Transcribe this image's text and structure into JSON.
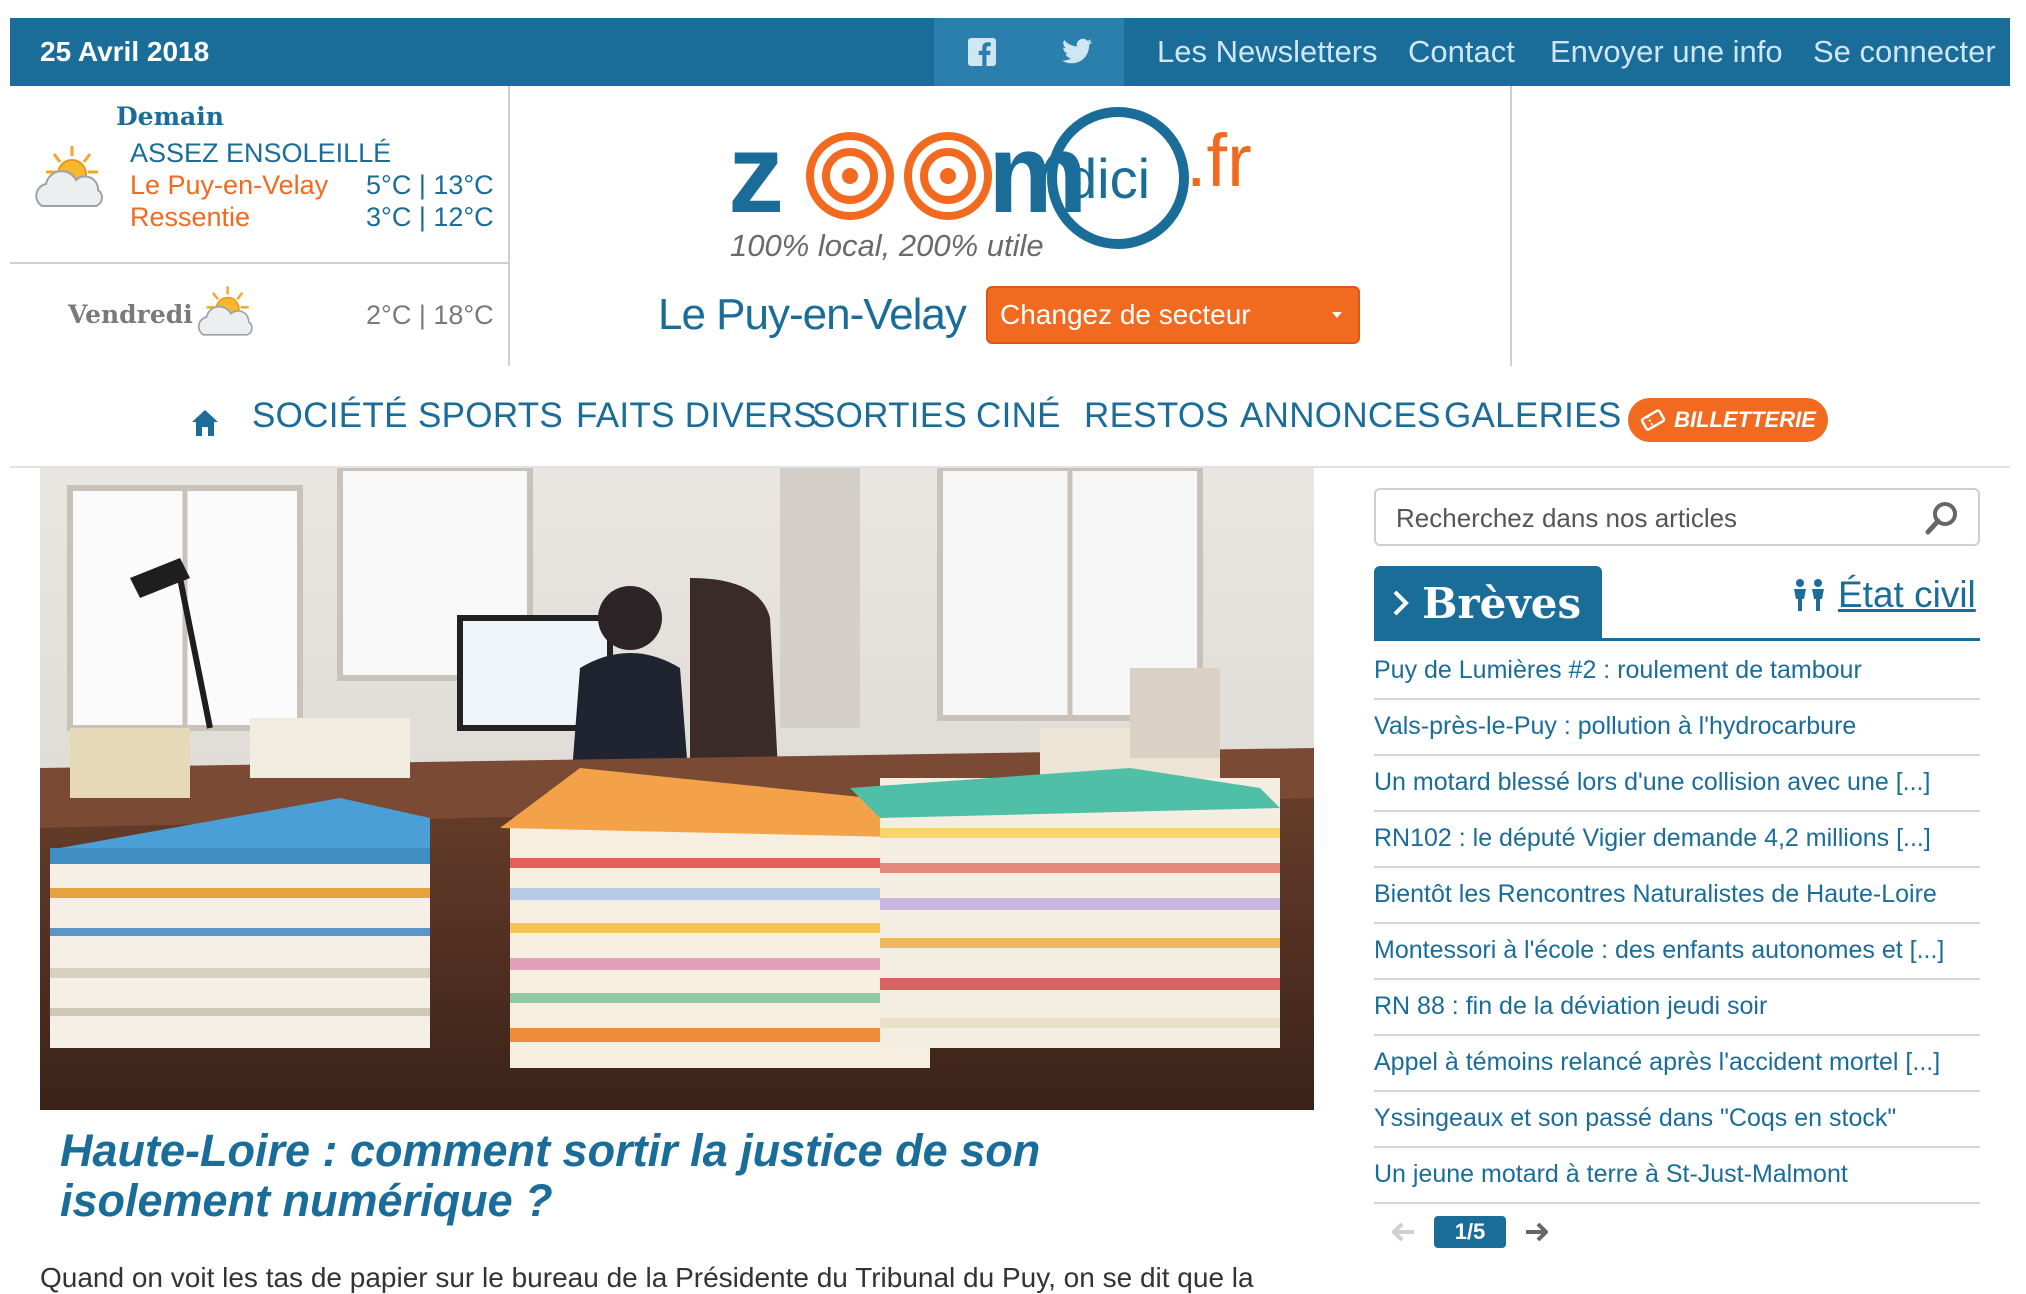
{
  "topbar": {
    "date": "25 Avril 2018",
    "social": [
      {
        "icon": "facebook-icon"
      },
      {
        "icon": "twitter-icon"
      }
    ],
    "links": [
      "Les Newsletters",
      "Contact",
      "Envoyer une info",
      "Se connecter"
    ]
  },
  "weather": {
    "tomorrow_label": "Demain",
    "condition": "ASSEZ ENSOLEILLÉ",
    "city": "Le Puy-en-Velay",
    "feels_label": "Ressentie",
    "temp": "5°C | 13°C",
    "feels_temp": "3°C | 12°C",
    "friday_label": "Vendredi",
    "friday_temp": "2°C | 18°C"
  },
  "brand": {
    "logo_text": "zoom dici .fr",
    "tagline": "100% local, 200% utile",
    "city": "Le Puy-en-Velay",
    "sector_button": "Changez de secteur",
    "colors": {
      "blue": "#1a6c99",
      "orange": "#f26a20"
    }
  },
  "nav": {
    "items": [
      "SOCIÉTÉ",
      "SPORTS",
      "FAITS DIVERS",
      "SORTIES",
      "CINÉ",
      "RESTOS",
      "ANNONCES",
      "GALERIES"
    ],
    "billetterie": "BILLETTERIE"
  },
  "article": {
    "headline": "Haute-Loire : comment sortir la justice de son isolement numérique ?",
    "excerpt": "Quand on voit les tas de papier sur le bureau de la Présidente du Tribunal du Puy, on se dit que la"
  },
  "sidebar": {
    "search_placeholder": "Recherchez dans nos articles",
    "breves_title": "Brèves",
    "etat_civil": "État civil",
    "briefs": [
      "Puy de Lumières #2 : roulement de tambour",
      "Vals-près-le-Puy : pollution à l'hydrocarbure",
      "Un motard blessé lors d'une collision avec une [...]",
      "RN102 : le député Vigier demande 4,2 millions [...]",
      "Bientôt les Rencontres Naturalistes de Haute-Loire",
      "Montessori à l'école : des enfants autonomes et [...]",
      "RN 88 : fin de la déviation jeudi soir",
      "Appel à témoins relancé après l'accident mortel [...]",
      "Yssingeaux et son passé dans \"Coqs en stock\"",
      "Un jeune motard à terre à St-Just-Malmont"
    ],
    "pager": "1/5"
  }
}
